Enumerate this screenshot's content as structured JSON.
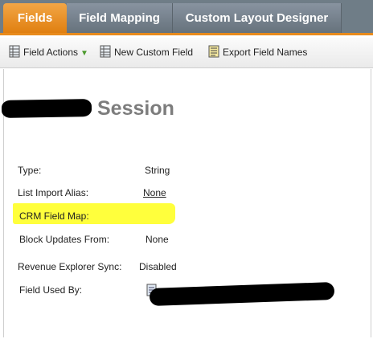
{
  "tabs": [
    {
      "label": "Fields",
      "active": true
    },
    {
      "label": "Field Mapping",
      "active": false
    },
    {
      "label": "Custom Layout Designer",
      "active": false
    }
  ],
  "toolbar": {
    "field_actions": {
      "label": "Field Actions",
      "icon": "table-icon"
    },
    "new_custom_field": {
      "label": "New Custom Field",
      "icon": "table-icon"
    },
    "export_field_names": {
      "label": "Export Field Names",
      "icon": "document-icon"
    }
  },
  "field": {
    "title": "Session",
    "properties": [
      {
        "label": "Type:",
        "value": "String"
      },
      {
        "label": "List Import Alias:",
        "value": "None"
      },
      {
        "label": "CRM Field Map:",
        "value": ""
      },
      {
        "label": "Block Updates From:",
        "value": "None"
      },
      {
        "label": "Revenue Explorer Sync:",
        "value": "Disabled"
      },
      {
        "label": "Field Used By:",
        "value": ""
      }
    ]
  },
  "colors": {
    "accent": "#e88a1c",
    "tab_bar": "#6f7d87",
    "highlight": "#ffff3c",
    "title": "#7d7d7d"
  }
}
